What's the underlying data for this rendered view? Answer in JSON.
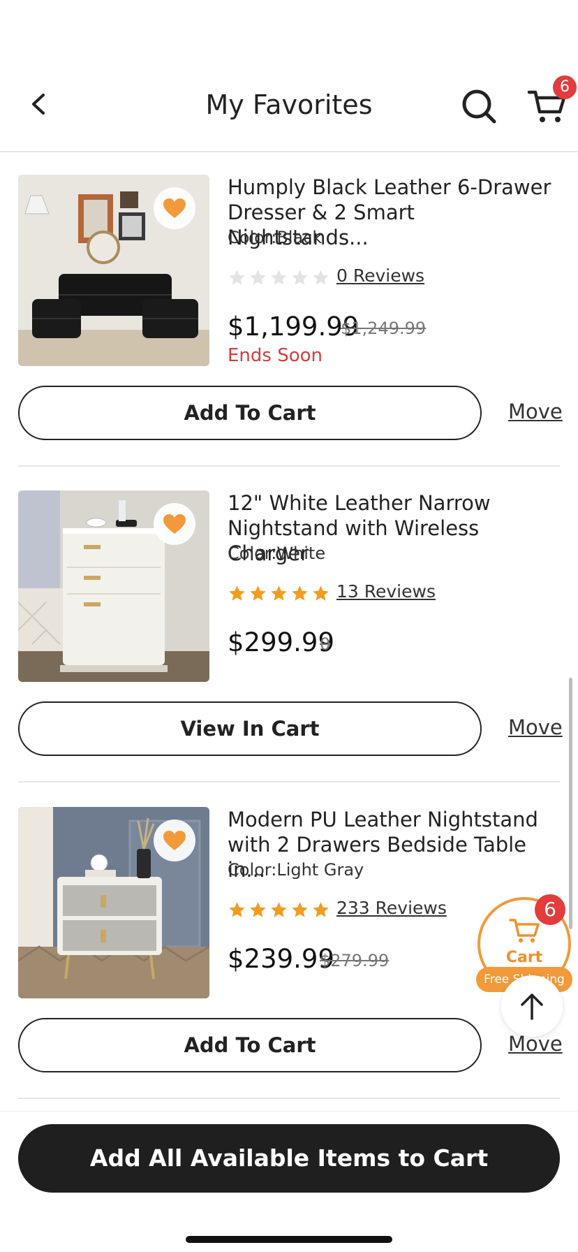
{
  "header": {
    "title": "My Favorites",
    "cart_count": "6"
  },
  "items": [
    {
      "name": "Humply Black Leather 6-Drawer Dresser & 2 Smart Nightstands...",
      "color": "Color:Black",
      "rating": 0,
      "reviews": "0 Reviews",
      "price": "$1,199.99",
      "old_price": "$1,249.99",
      "promo": "Ends Soon",
      "action": "Add To Cart",
      "move": "Move"
    },
    {
      "name": "12\" White Leather Narrow Nightstand with Wireless Charger",
      "color": "Color:White",
      "rating": 5,
      "reviews": "13 Reviews",
      "price": "$299.99",
      "old_price": "0",
      "action": "View In Cart",
      "move": "Move"
    },
    {
      "name": "Modern PU Leather Nightstand with 2 Drawers Bedside Table in...",
      "color": "Color:Light Gray",
      "rating": 5,
      "reviews": "233 Reviews",
      "price": "$239.99",
      "old_price": "$279.99",
      "action": "Add To Cart",
      "move": "Move"
    }
  ],
  "floating_cart": {
    "label": "Cart",
    "count": "6",
    "shipping": "Free Shipping"
  },
  "footer": {
    "add_all_label": "Add All Available Items to Cart"
  },
  "colors": {
    "accent_orange": "#f29a3a",
    "badge_red": "#e23c3c",
    "star_gold": "#f39c1f",
    "star_empty": "#e3e3e3",
    "promo_red": "#d43c3c",
    "dark_button": "#1f1f1f"
  }
}
